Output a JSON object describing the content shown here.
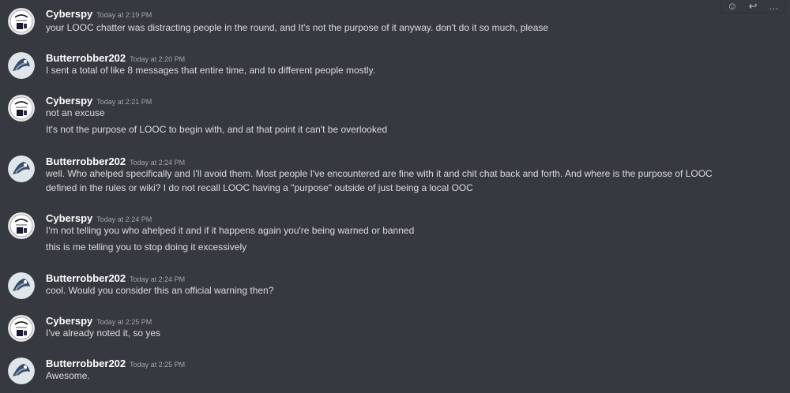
{
  "toolbar": {
    "icons": [
      "add-reaction-icon",
      "reply-icon",
      "more-icon"
    ],
    "reaction_glyph": "☺",
    "reply_glyph": "↩",
    "more_glyph": "…"
  },
  "colors": {
    "background": "#36393f",
    "username": "#ffffff",
    "message_text": "#dcddde",
    "timestamp": "#a3a6aa"
  },
  "messages": [
    {
      "author": "Cyberspy",
      "timestamp": "Today at 2:19 PM",
      "lines": [
        "your LOOC chatter was distracting people in the round, and It's not the purpose of it anyway. don't do it so much, please"
      ]
    },
    {
      "author": "Butterrobber202",
      "timestamp": "Today at 2:20 PM",
      "lines": [
        "I sent a total of like 8 messages that entire time, and to different people mostly."
      ]
    },
    {
      "author": "Cyberspy",
      "timestamp": "Today at 2:21 PM",
      "lines": [
        "not an excuse",
        "It's not the purpose of LOOC to begin with, and at that point it can't be overlooked"
      ]
    },
    {
      "author": "Butterrobber202",
      "timestamp": "Today at 2:24 PM",
      "lines": [
        "well. Who ahelped specifically and I'll avoid them. Most people I've encountered are fine with it and chit chat back and forth. And where is the purpose of LOOC",
        "defined in the rules or wiki? I do not recall LOOC having a \"purpose\" outside of just being a local OOC"
      ]
    },
    {
      "author": "Cyberspy",
      "timestamp": "Today at 2:24 PM",
      "lines": [
        "I'm not telling you who ahelped it and if it happens again you're being warned or banned",
        "this is me telling you to stop doing it excessively"
      ]
    },
    {
      "author": "Butterrobber202",
      "timestamp": "Today at 2:24 PM",
      "lines": [
        "cool. Would you consider this an official warning then?"
      ]
    },
    {
      "author": "Cyberspy",
      "timestamp": "Today at 2:25 PM",
      "lines": [
        "I've already noted it, so yes"
      ]
    },
    {
      "author": "Butterrobber202",
      "timestamp": "Today at 2:25 PM",
      "lines": [
        "Awesome."
      ]
    }
  ]
}
